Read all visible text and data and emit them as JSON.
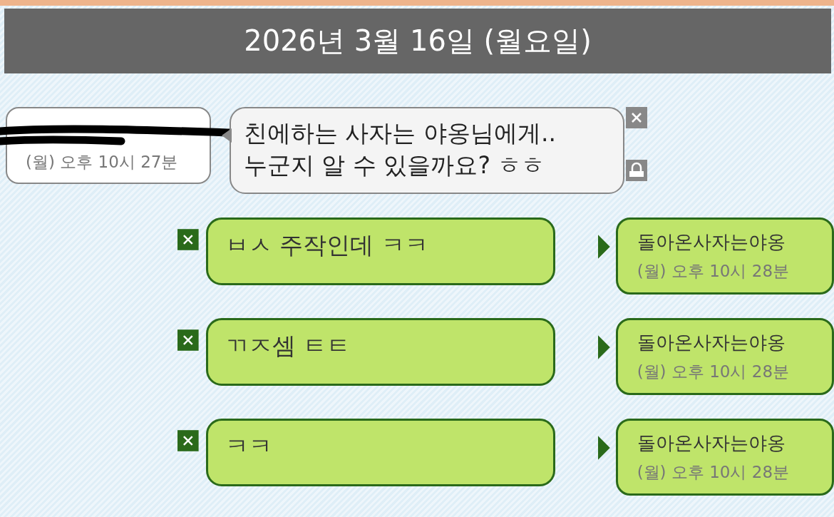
{
  "header": {
    "title": "2026년 3월 16일 (월요일)"
  },
  "messages": [
    {
      "kind": "incoming",
      "time": "(월) 오후 10시 27분",
      "lines": [
        "친에하는 사자는 야옹님에게..",
        "누군지 알 수 있을까요? ㅎㅎ"
      ]
    },
    {
      "kind": "outgoing",
      "sender": "돌아온사자는야옹",
      "time": "(월) 오후 10시 28분",
      "lines": [
        "ㅂㅅ 주작인데 ㅋㅋ"
      ]
    },
    {
      "kind": "outgoing",
      "sender": "돌아온사자는야옹",
      "time": "(월) 오후 10시 28분",
      "lines": [
        "ㄲㅈ셈 ㅌㅌ"
      ]
    },
    {
      "kind": "outgoing",
      "sender": "돌아온사자는야옹",
      "time": "(월) 오후 10시 28분",
      "lines": [
        "ㅋㅋ"
      ]
    }
  ]
}
